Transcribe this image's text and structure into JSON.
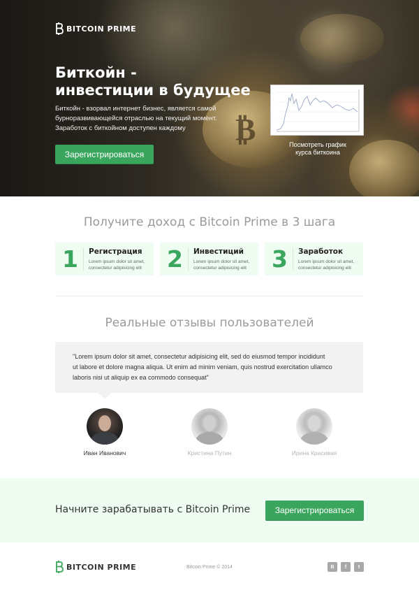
{
  "brand": {
    "name": "Bitcoin Prime",
    "accent_color": "#3aa55d",
    "logo_icon": "bitcoin-b-icon"
  },
  "hero": {
    "title_line1": "Биткойн -",
    "title_line2": "инвестиции в будущее",
    "desc_line1": "Биткойн - взорвал интернет бизнес, является самой",
    "desc_line2": "бурноразвивающейся отраслью на текущий момент.",
    "desc_line3": "Заработок с биткойном доступен каждому",
    "register_label": "Зарегистрироваться",
    "chart_caption_line1": "Посмотреть график",
    "chart_caption_line2": "курса биткоина"
  },
  "steps": {
    "title": "Получите доход с Bitcoin Prime в 3 шага",
    "items": [
      {
        "number": "1",
        "heading": "Регистрация",
        "text_line1": "Lorem ipsum dolor sit amet,",
        "text_line2": "consectetur adipisicing elit"
      },
      {
        "number": "2",
        "heading": "Инвестиций",
        "text_line1": "Lorem ipsum dolor sit amet,",
        "text_line2": "consectetur adipisicing elit"
      },
      {
        "number": "3",
        "heading": "Заработок",
        "text_line1": "Lorem ipsum dolor sit amet,",
        "text_line2": "consectetur adipisicing elit"
      }
    ]
  },
  "reviews": {
    "title": "Реальные отзывы пользователей",
    "quote_line1": "\"Lorem ipsum dolor sit amet, consectetur adipisicing elit, sed do eiusmod tempor incididunt",
    "quote_line2": "ut labore et dolore magna aliqua. Ut enim ad minim veniam, quis nostrud exercitation ullamco",
    "quote_line3": "laboris nisi ut aliquip ex ea commodo consequat\"",
    "people": [
      {
        "name": "Иван Иванович",
        "active": true
      },
      {
        "name": "Кристина Путин",
        "active": false
      },
      {
        "name": "Ирина Красивая",
        "active": false
      }
    ]
  },
  "cta": {
    "text": "Начните зарабатывать с Bitcoin Prime",
    "register_label": "Зарегистрироваться"
  },
  "footer": {
    "copyright": "Bitcoin Prime © 2014",
    "social": [
      {
        "icon": "vk-icon",
        "glyph": "B"
      },
      {
        "icon": "facebook-icon",
        "glyph": "f"
      },
      {
        "icon": "twitter-icon",
        "glyph": "t"
      }
    ]
  }
}
